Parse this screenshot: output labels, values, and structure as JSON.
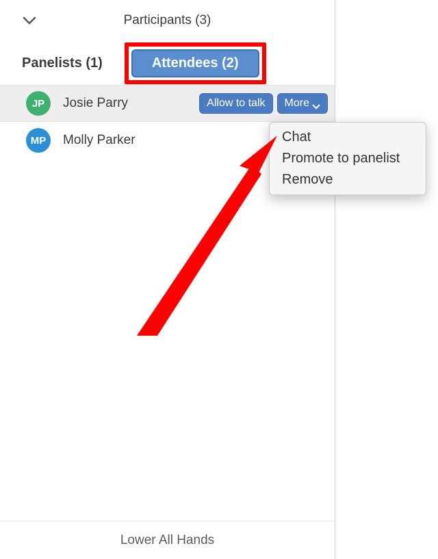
{
  "header": {
    "title": "Participants (3)"
  },
  "tabs": {
    "panelists": "Panelists (1)",
    "attendees": "Attendees (2)"
  },
  "attendees": [
    {
      "initials": "JP",
      "name": "Josie Parry",
      "avatar_color": "green",
      "hovered": true
    },
    {
      "initials": "MP",
      "name": "Molly Parker",
      "avatar_color": "blue",
      "hovered": false
    }
  ],
  "row_actions": {
    "allow_to_talk": "Allow to talk",
    "more": "More"
  },
  "more_menu": {
    "chat": "Chat",
    "promote": "Promote to panelist",
    "remove": "Remove"
  },
  "footer": {
    "lower_all_hands": "Lower All Hands"
  }
}
